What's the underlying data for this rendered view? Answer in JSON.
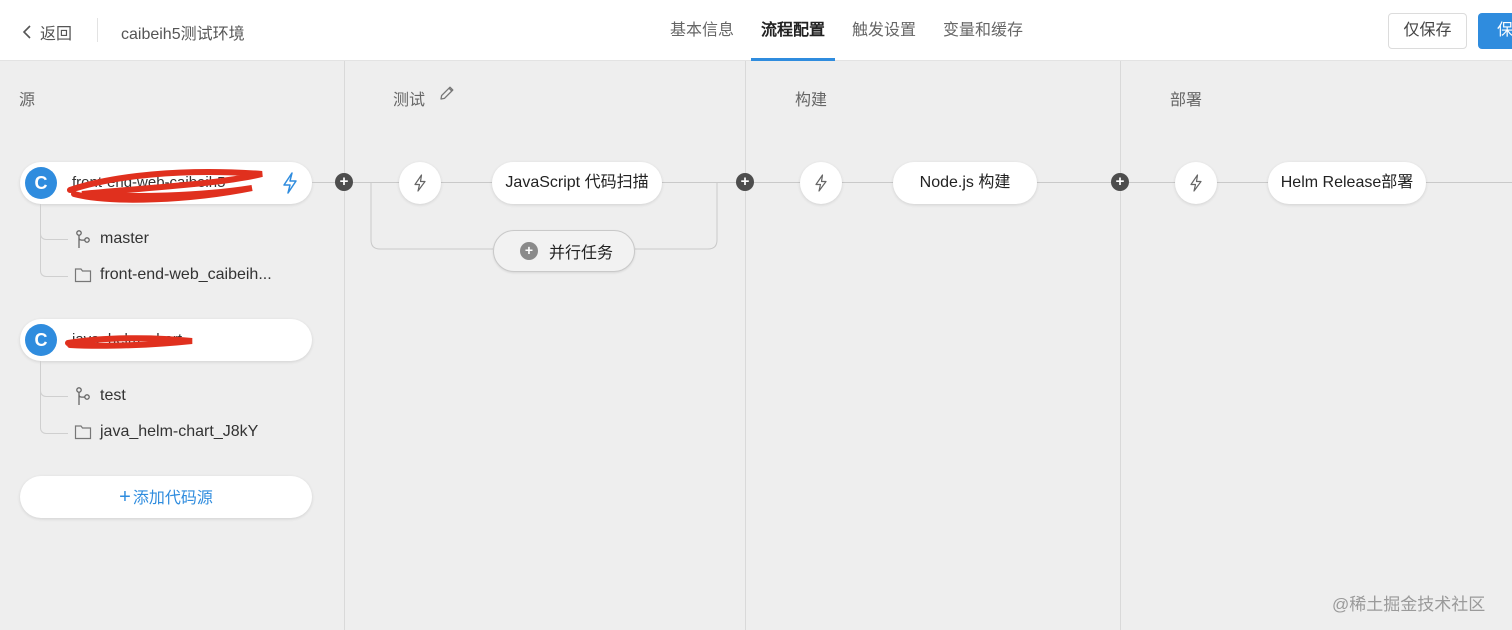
{
  "header": {
    "back_label": "返回",
    "app_title": "caibeih5测试环境",
    "tabs": [
      {
        "label": "基本信息",
        "active": false
      },
      {
        "label": "流程配置",
        "active": true
      },
      {
        "label": "触发设置",
        "active": false
      },
      {
        "label": "变量和缓存",
        "active": false
      }
    ],
    "save_only_label": "仅保存",
    "save_label": "保"
  },
  "stages": {
    "source": "源",
    "test": "测试",
    "build": "构建",
    "deploy": "部署"
  },
  "sources": [
    {
      "logo": "C",
      "name": "front-end-web-caibeih5",
      "branch": "master",
      "path": "front-end-web_caibeih..."
    },
    {
      "logo": "C",
      "name": "java_helm_chart",
      "branch": "test",
      "path": "java_helm-chart_J8kY"
    }
  ],
  "add_source_label": "添加代码源",
  "tasks": {
    "test": "JavaScript 代码扫描",
    "parallel": "并行任务",
    "build": "Node.js 构建",
    "deploy": "Helm Release部署"
  },
  "watermark": "@稀土掘金技术社区",
  "colors": {
    "accent": "#2f8cde",
    "redaction": "#e0301e"
  }
}
